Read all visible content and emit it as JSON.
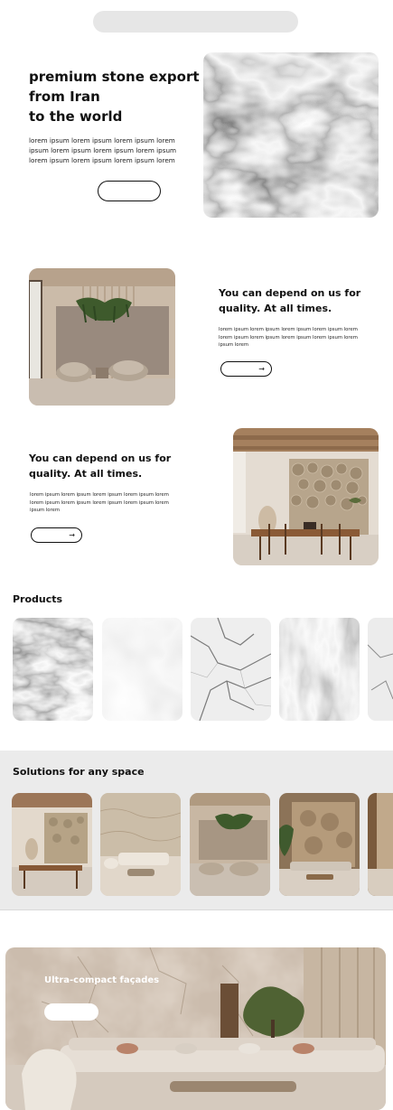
{
  "search": {
    "placeholder": ""
  },
  "hero": {
    "title_lines": [
      "premium stone export",
      "from Iran",
      "to the world"
    ],
    "body": "lorem ipsum lorem ipsum lorem ipsum lorem ipsum lorem ipsum lorem ipsum lorem ipsum lorem ipsum lorem ipsum lorem ipsum lorem",
    "button_label": ""
  },
  "feature_1": {
    "title_lines": [
      "You can depend on us for",
      "quality. At all times."
    ],
    "body": "lorem ipsum lorem ipsum lorem ipsum lorem ipsum lorem lorem ipsum lorem ipsum lorem ipsum lorem ipsum lorem ipsum lorem",
    "button_icon": "arrow-right-icon"
  },
  "feature_2": {
    "title_lines": [
      "You can depend on us for",
      "quality. At all times."
    ],
    "body": "lorem ipsum lorem ipsum lorem ipsum lorem ipsum lorem lorem ipsum lorem ipsum lorem ipsum lorem ipsum lorem ipsum lorem",
    "button_icon": "arrow-right-icon"
  },
  "products": {
    "title": "Products",
    "items": [
      {
        "name": "swirl-marble"
      },
      {
        "name": "cloudy-grey-marble"
      },
      {
        "name": "white-veined-marble"
      },
      {
        "name": "dark-veined-marble"
      },
      {
        "name": "partial-marble"
      }
    ]
  },
  "solutions": {
    "title": "Solutions for any space",
    "items": [
      {
        "name": "dining-room"
      },
      {
        "name": "stone-wall-lounge"
      },
      {
        "name": "plant-wall-lounge"
      },
      {
        "name": "rock-wall-living-room"
      },
      {
        "name": "partial-interior"
      }
    ]
  },
  "banner": {
    "title": "Ultra-compact façades",
    "button_label": ""
  },
  "arrow_glyph": "→",
  "colors": {
    "accent": "#111111",
    "surface": "#ebebeb",
    "stone": "#c9b8a6"
  }
}
